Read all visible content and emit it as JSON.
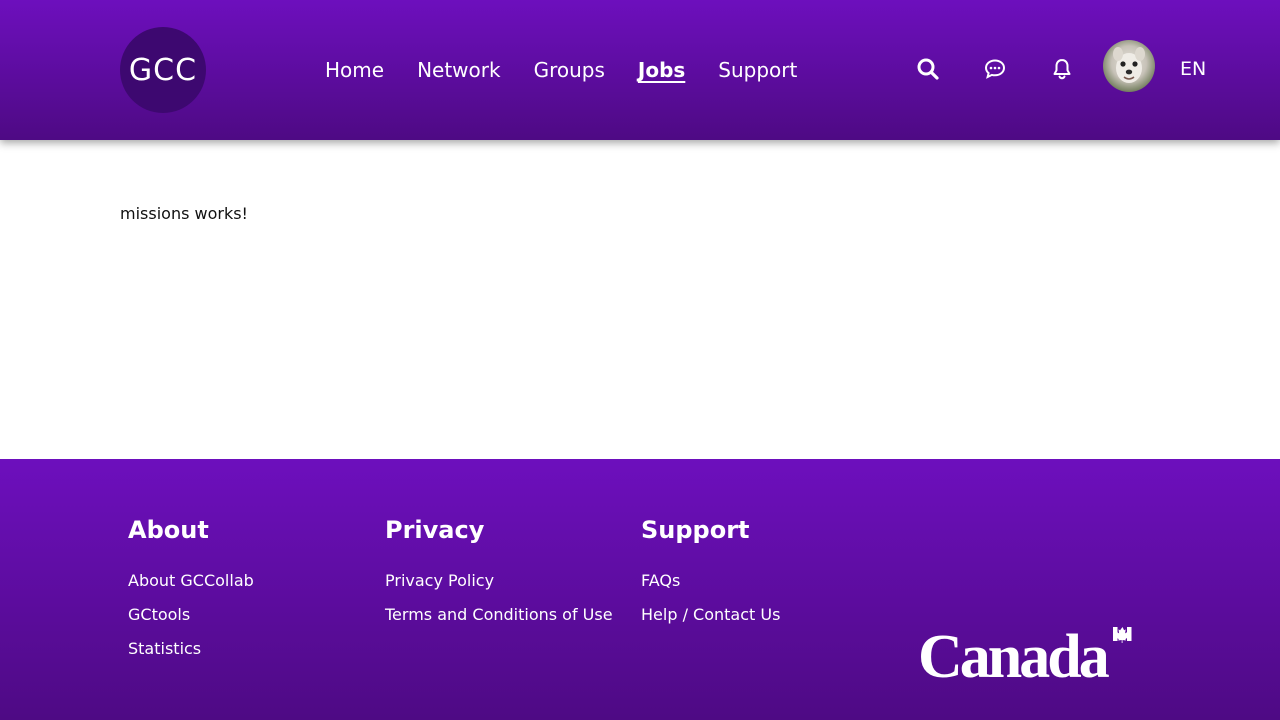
{
  "header": {
    "logo_text": "GCC",
    "nav": [
      {
        "label": "Home"
      },
      {
        "label": "Network"
      },
      {
        "label": "Groups"
      },
      {
        "label": "Jobs",
        "active": true
      },
      {
        "label": "Support"
      }
    ],
    "icons": [
      "search-icon",
      "messages-icon",
      "notifications-bell-icon",
      "user-avatar"
    ],
    "language_toggle": "EN"
  },
  "main": {
    "text": "missions works!"
  },
  "footer": {
    "columns": [
      {
        "heading": "About",
        "links": [
          "About GCCollab",
          "GCtools",
          "Statistics"
        ]
      },
      {
        "heading": "Privacy",
        "links": [
          "Privacy Policy",
          "Terms and Conditions of Use"
        ]
      },
      {
        "heading": "Support",
        "links": [
          "FAQs",
          "Help / Contact Us"
        ]
      }
    ],
    "wordmark": "Canada"
  },
  "colors": {
    "brand_purple_top": "#6d0fbd",
    "brand_purple_bottom": "#4e0a84",
    "logo_circle": "#3d0870",
    "text_on_brand": "#ffffff"
  }
}
